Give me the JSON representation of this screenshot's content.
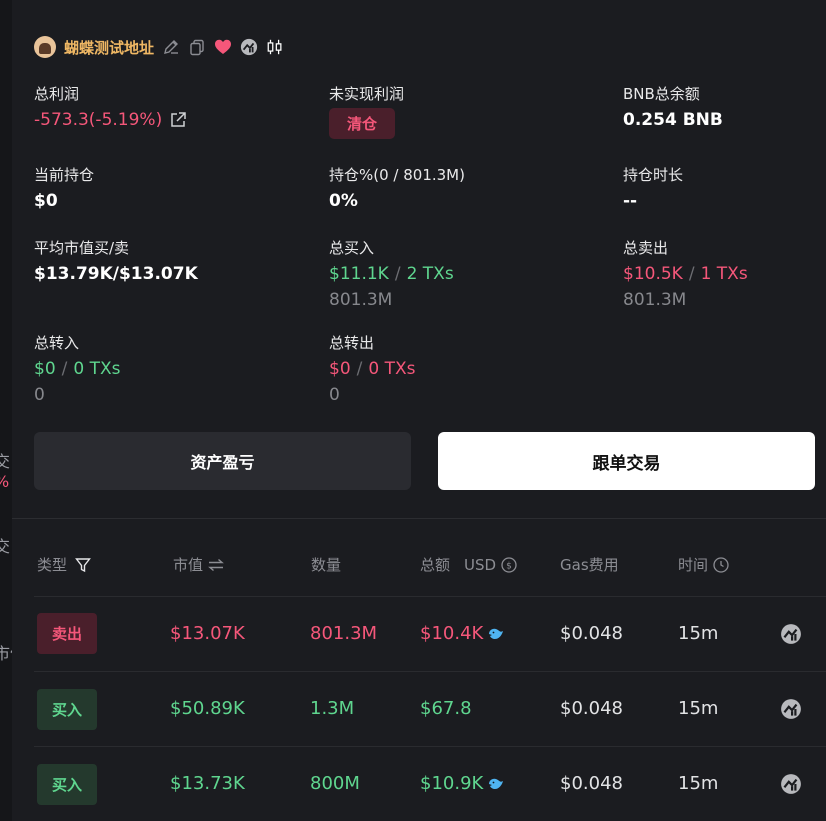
{
  "header": {
    "name": "蝴蝶测试地址"
  },
  "stats": {
    "total_profit": {
      "label": "总利润",
      "value": "-573.3(-5.19%)"
    },
    "unrealized": {
      "label": "未实现利润",
      "button": "清仓"
    },
    "bnb_balance": {
      "label": "BNB总余额",
      "value": "0.254 BNB"
    },
    "holding": {
      "label": "当前持仓",
      "value": "$0"
    },
    "holding_pct": {
      "label": "持仓%(0 / 801.3M)",
      "value": "0%"
    },
    "holding_time": {
      "label": "持仓时长",
      "value": "--"
    },
    "avg_mcap": {
      "label": "平均市值买/卖",
      "value": "$13.79K/$13.07K"
    },
    "total_buy": {
      "label": "总买入",
      "amount": "$11.1K",
      "sep": "/",
      "txs": "2 TXs",
      "qty": "801.3M"
    },
    "total_sell": {
      "label": "总卖出",
      "amount": "$10.5K",
      "sep": "/",
      "txs": "1 TXs",
      "qty": "801.3M"
    },
    "total_in": {
      "label": "总转入",
      "amount": "$0",
      "sep": "/",
      "txs": "0 TXs",
      "qty": "0"
    },
    "total_out": {
      "label": "总转出",
      "amount": "$0",
      "sep": "/",
      "txs": "0 TXs",
      "qty": "0"
    }
  },
  "buttons": {
    "pnl": "资产盈亏",
    "copy_trade": "跟单交易"
  },
  "table": {
    "headers": {
      "type": "类型",
      "mcap": "市值",
      "qty": "数量",
      "total": "总额",
      "currency": "USD",
      "gas": "Gas费用",
      "time": "时间"
    },
    "rows": [
      {
        "type": "卖出",
        "side": "sell",
        "mcap": "$13.07K",
        "qty": "801.3M",
        "total": "$10.4K",
        "whale": true,
        "gas": "$0.048",
        "time": "15m"
      },
      {
        "type": "买入",
        "side": "buy",
        "mcap": "$50.89K",
        "qty": "1.3M",
        "total": "$67.8",
        "whale": false,
        "gas": "$0.048",
        "time": "15m"
      },
      {
        "type": "买入",
        "side": "buy",
        "mcap": "$13.73K",
        "qty": "800M",
        "total": "$10.9K",
        "whale": true,
        "gas": "$0.048",
        "time": "15m"
      }
    ]
  },
  "background": {
    "fragments": [
      "交",
      "%",
      "交",
      "市值"
    ]
  },
  "colors": {
    "accent_red": "#f5577a",
    "accent_green": "#5fd68f",
    "name_gold": "#f0b864"
  }
}
